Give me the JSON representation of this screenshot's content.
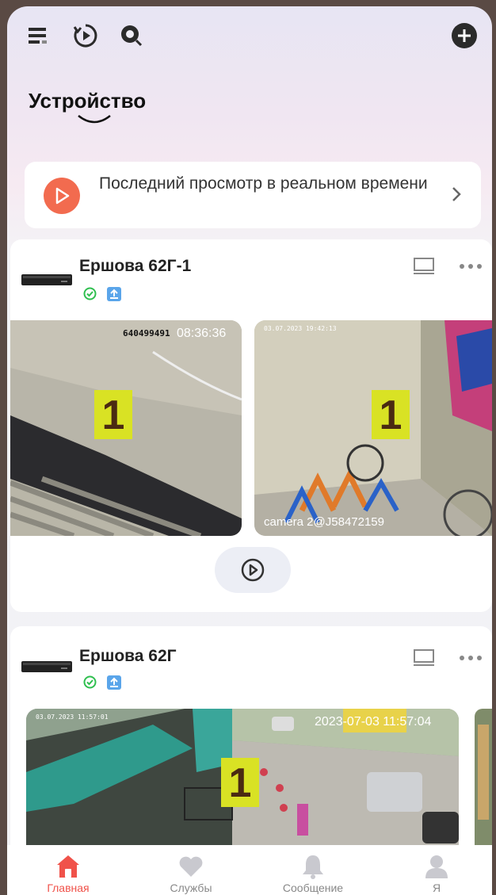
{
  "header": {
    "title": "Устройство"
  },
  "last_live": {
    "text": "Последний просмотр в реальном времени"
  },
  "devices": [
    {
      "name": "Ершова 62Г-1",
      "cameras": [
        {
          "channel_badge": "1",
          "id_overlay": "640499491",
          "time_overlay": "08:36:36"
        },
        {
          "channel_badge": "1",
          "date_overlay": "03.07.2023 19:42:13",
          "name_overlay": "camera 2@J58472159"
        }
      ]
    },
    {
      "name": "Ершова 62Г",
      "cameras": [
        {
          "channel_badge": "1",
          "date_overlay": "03.07.2023 11:57:01",
          "time_overlay": "2023-07-03 11:57:04"
        }
      ]
    }
  ],
  "nav": {
    "items": [
      {
        "label": "Главная",
        "icon": "home-icon",
        "active": true
      },
      {
        "label": "Службы",
        "icon": "heart-icon",
        "active": false
      },
      {
        "label": "Сообщение",
        "icon": "bell-icon",
        "active": false
      },
      {
        "label": "Я",
        "icon": "user-icon",
        "active": false
      }
    ]
  },
  "colors": {
    "accent": "#f26b4f",
    "active_nav": "#f0524a",
    "badge": "#d9e224",
    "online": "#2fbf4f",
    "cloud": "#5aa5ea"
  }
}
